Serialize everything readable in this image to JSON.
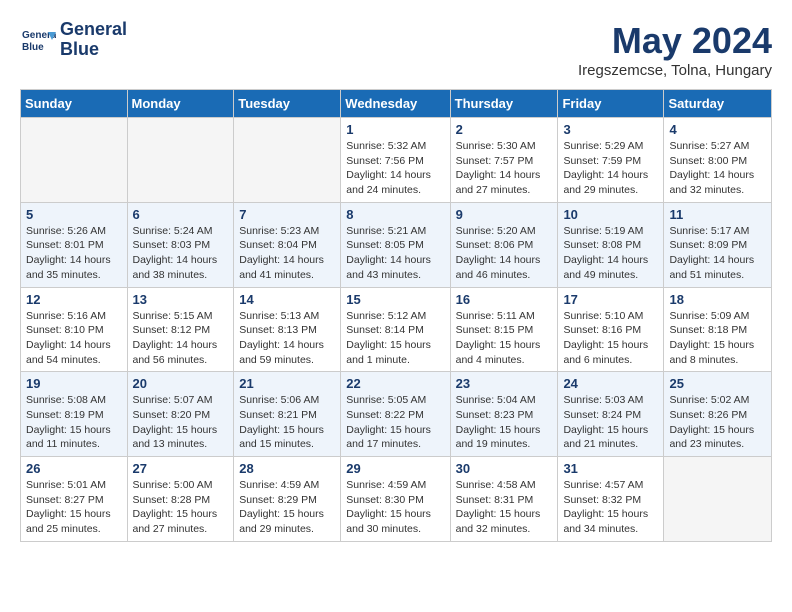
{
  "header": {
    "logo_line1": "General",
    "logo_line2": "Blue",
    "month": "May 2024",
    "location": "Iregszemcse, Tolna, Hungary"
  },
  "days_of_week": [
    "Sunday",
    "Monday",
    "Tuesday",
    "Wednesday",
    "Thursday",
    "Friday",
    "Saturday"
  ],
  "weeks": [
    [
      {
        "day": "",
        "info": ""
      },
      {
        "day": "",
        "info": ""
      },
      {
        "day": "",
        "info": ""
      },
      {
        "day": "1",
        "info": "Sunrise: 5:32 AM\nSunset: 7:56 PM\nDaylight: 14 hours and 24 minutes."
      },
      {
        "day": "2",
        "info": "Sunrise: 5:30 AM\nSunset: 7:57 PM\nDaylight: 14 hours and 27 minutes."
      },
      {
        "day": "3",
        "info": "Sunrise: 5:29 AM\nSunset: 7:59 PM\nDaylight: 14 hours and 29 minutes."
      },
      {
        "day": "4",
        "info": "Sunrise: 5:27 AM\nSunset: 8:00 PM\nDaylight: 14 hours and 32 minutes."
      }
    ],
    [
      {
        "day": "5",
        "info": "Sunrise: 5:26 AM\nSunset: 8:01 PM\nDaylight: 14 hours and 35 minutes."
      },
      {
        "day": "6",
        "info": "Sunrise: 5:24 AM\nSunset: 8:03 PM\nDaylight: 14 hours and 38 minutes."
      },
      {
        "day": "7",
        "info": "Sunrise: 5:23 AM\nSunset: 8:04 PM\nDaylight: 14 hours and 41 minutes."
      },
      {
        "day": "8",
        "info": "Sunrise: 5:21 AM\nSunset: 8:05 PM\nDaylight: 14 hours and 43 minutes."
      },
      {
        "day": "9",
        "info": "Sunrise: 5:20 AM\nSunset: 8:06 PM\nDaylight: 14 hours and 46 minutes."
      },
      {
        "day": "10",
        "info": "Sunrise: 5:19 AM\nSunset: 8:08 PM\nDaylight: 14 hours and 49 minutes."
      },
      {
        "day": "11",
        "info": "Sunrise: 5:17 AM\nSunset: 8:09 PM\nDaylight: 14 hours and 51 minutes."
      }
    ],
    [
      {
        "day": "12",
        "info": "Sunrise: 5:16 AM\nSunset: 8:10 PM\nDaylight: 14 hours and 54 minutes."
      },
      {
        "day": "13",
        "info": "Sunrise: 5:15 AM\nSunset: 8:12 PM\nDaylight: 14 hours and 56 minutes."
      },
      {
        "day": "14",
        "info": "Sunrise: 5:13 AM\nSunset: 8:13 PM\nDaylight: 14 hours and 59 minutes."
      },
      {
        "day": "15",
        "info": "Sunrise: 5:12 AM\nSunset: 8:14 PM\nDaylight: 15 hours and 1 minute."
      },
      {
        "day": "16",
        "info": "Sunrise: 5:11 AM\nSunset: 8:15 PM\nDaylight: 15 hours and 4 minutes."
      },
      {
        "day": "17",
        "info": "Sunrise: 5:10 AM\nSunset: 8:16 PM\nDaylight: 15 hours and 6 minutes."
      },
      {
        "day": "18",
        "info": "Sunrise: 5:09 AM\nSunset: 8:18 PM\nDaylight: 15 hours and 8 minutes."
      }
    ],
    [
      {
        "day": "19",
        "info": "Sunrise: 5:08 AM\nSunset: 8:19 PM\nDaylight: 15 hours and 11 minutes."
      },
      {
        "day": "20",
        "info": "Sunrise: 5:07 AM\nSunset: 8:20 PM\nDaylight: 15 hours and 13 minutes."
      },
      {
        "day": "21",
        "info": "Sunrise: 5:06 AM\nSunset: 8:21 PM\nDaylight: 15 hours and 15 minutes."
      },
      {
        "day": "22",
        "info": "Sunrise: 5:05 AM\nSunset: 8:22 PM\nDaylight: 15 hours and 17 minutes."
      },
      {
        "day": "23",
        "info": "Sunrise: 5:04 AM\nSunset: 8:23 PM\nDaylight: 15 hours and 19 minutes."
      },
      {
        "day": "24",
        "info": "Sunrise: 5:03 AM\nSunset: 8:24 PM\nDaylight: 15 hours and 21 minutes."
      },
      {
        "day": "25",
        "info": "Sunrise: 5:02 AM\nSunset: 8:26 PM\nDaylight: 15 hours and 23 minutes."
      }
    ],
    [
      {
        "day": "26",
        "info": "Sunrise: 5:01 AM\nSunset: 8:27 PM\nDaylight: 15 hours and 25 minutes."
      },
      {
        "day": "27",
        "info": "Sunrise: 5:00 AM\nSunset: 8:28 PM\nDaylight: 15 hours and 27 minutes."
      },
      {
        "day": "28",
        "info": "Sunrise: 4:59 AM\nSunset: 8:29 PM\nDaylight: 15 hours and 29 minutes."
      },
      {
        "day": "29",
        "info": "Sunrise: 4:59 AM\nSunset: 8:30 PM\nDaylight: 15 hours and 30 minutes."
      },
      {
        "day": "30",
        "info": "Sunrise: 4:58 AM\nSunset: 8:31 PM\nDaylight: 15 hours and 32 minutes."
      },
      {
        "day": "31",
        "info": "Sunrise: 4:57 AM\nSunset: 8:32 PM\nDaylight: 15 hours and 34 minutes."
      },
      {
        "day": "",
        "info": ""
      }
    ]
  ]
}
